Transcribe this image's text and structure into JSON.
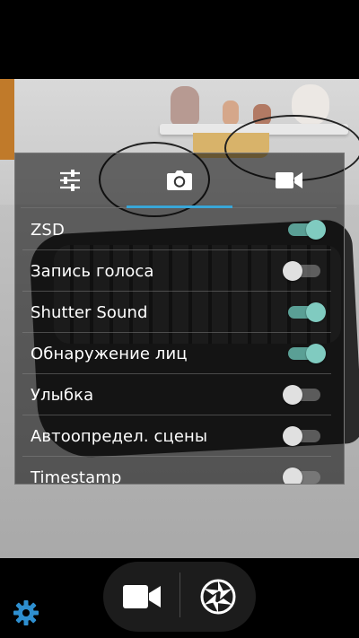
{
  "tabs": [
    {
      "icon": "sliders-icon"
    },
    {
      "icon": "camera-icon",
      "selected": true
    },
    {
      "icon": "video-camera-icon"
    }
  ],
  "settings": [
    {
      "label": "ZSD",
      "on": true
    },
    {
      "label": "Запись голоса",
      "on": false
    },
    {
      "label": "Shutter Sound",
      "on": true
    },
    {
      "label": "Обнаружение лиц",
      "on": true
    },
    {
      "label": "Улыбка",
      "on": false
    },
    {
      "label": "Автоопредел. сцены",
      "on": false
    },
    {
      "label": "Timestamp",
      "on": false
    }
  ],
  "bottom": {
    "video_icon": "video-camera-icon",
    "shutter_icon": "shutter-icon",
    "settings_icon": "gear-icon"
  },
  "colors": {
    "accent": "#39a7d8",
    "switch_on": "#80cbc0",
    "gear": "#2e8fd0"
  }
}
